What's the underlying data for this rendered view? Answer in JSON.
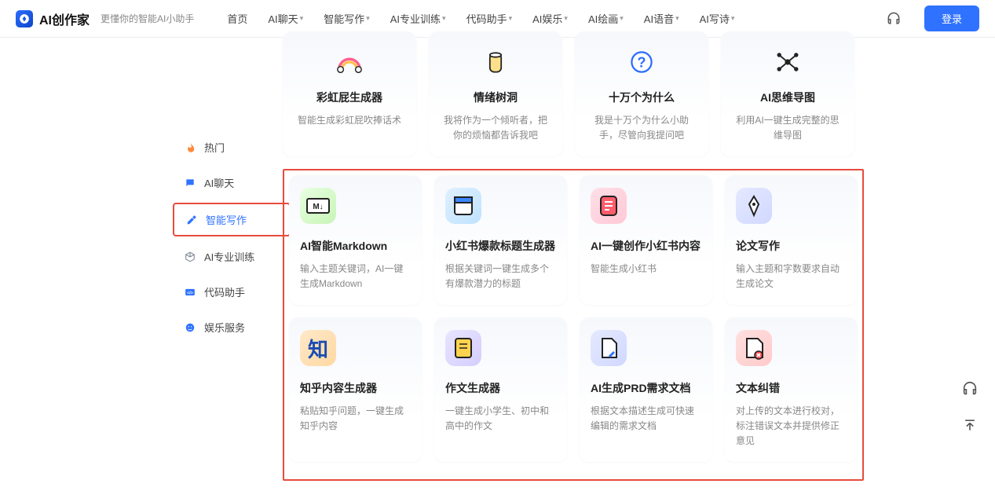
{
  "header": {
    "logo_text": "AI创作家",
    "tagline": "更懂你的智能AI小助手",
    "nav": [
      "首页",
      "AI聊天",
      "智能写作",
      "AI专业训练",
      "代码助手",
      "AI娱乐",
      "AI绘画",
      "AI语音",
      "AI写诗"
    ],
    "login_label": "登录"
  },
  "sidebar": {
    "items": [
      {
        "icon": "fire-icon",
        "label": "热门",
        "color": "#ff8a3d"
      },
      {
        "icon": "chat-icon",
        "label": "AI聊天",
        "color": "#2f72ff"
      },
      {
        "icon": "edit-icon",
        "label": "智能写作",
        "color": "#2f72ff",
        "active": true
      },
      {
        "icon": "cube-icon",
        "label": "AI专业训练",
        "color": "#7a8594"
      },
      {
        "icon": "code-icon",
        "label": "代码助手",
        "color": "#2f72ff"
      },
      {
        "icon": "smile-icon",
        "label": "娱乐服务",
        "color": "#2f72ff"
      }
    ]
  },
  "cards_top": [
    {
      "icon": "rainbow-icon",
      "title": "彩虹屁生成器",
      "desc": "智能生成彩虹屁吹捧话术"
    },
    {
      "icon": "jar-icon",
      "title": "情绪树洞",
      "desc": "我将作为一个倾听者，把你的烦恼都告诉我吧"
    },
    {
      "icon": "question-icon",
      "title": "十万个为什么",
      "desc": "我是十万个为什么小助手，尽管向我提问吧"
    },
    {
      "icon": "mindmap-icon",
      "title": "AI思维导图",
      "desc": "利用AI一键生成完整的思维导图"
    }
  ],
  "cards_mid": [
    {
      "icon": "markdown-icon",
      "title": "AI智能Markdown",
      "desc": "输入主题关键词，AI一键生成Markdown"
    },
    {
      "icon": "window-icon",
      "title": "小红书爆款标题生成器",
      "desc": "根据关键词一键生成多个有爆款潜力的标题"
    },
    {
      "icon": "note-icon",
      "title": "AI一键创作小红书内容",
      "desc": "智能生成小红书"
    },
    {
      "icon": "pen-icon",
      "title": "论文写作",
      "desc": "输入主题和字数要求自动生成论文"
    }
  ],
  "cards_bot": [
    {
      "icon": "zhi-icon",
      "title": "知乎内容生成器",
      "desc": "粘贴知乎问题，一键生成知乎内容"
    },
    {
      "icon": "essay-icon",
      "title": "作文生成器",
      "desc": "一键生成小学生、初中和高中的作文"
    },
    {
      "icon": "prd-icon",
      "title": "AI生成PRD需求文档",
      "desc": "根据文本描述生成可快速编辑的需求文档"
    },
    {
      "icon": "correct-icon",
      "title": "文本纠错",
      "desc": "对上传的文本进行校对，标注错误文本并提供修正意见"
    }
  ]
}
